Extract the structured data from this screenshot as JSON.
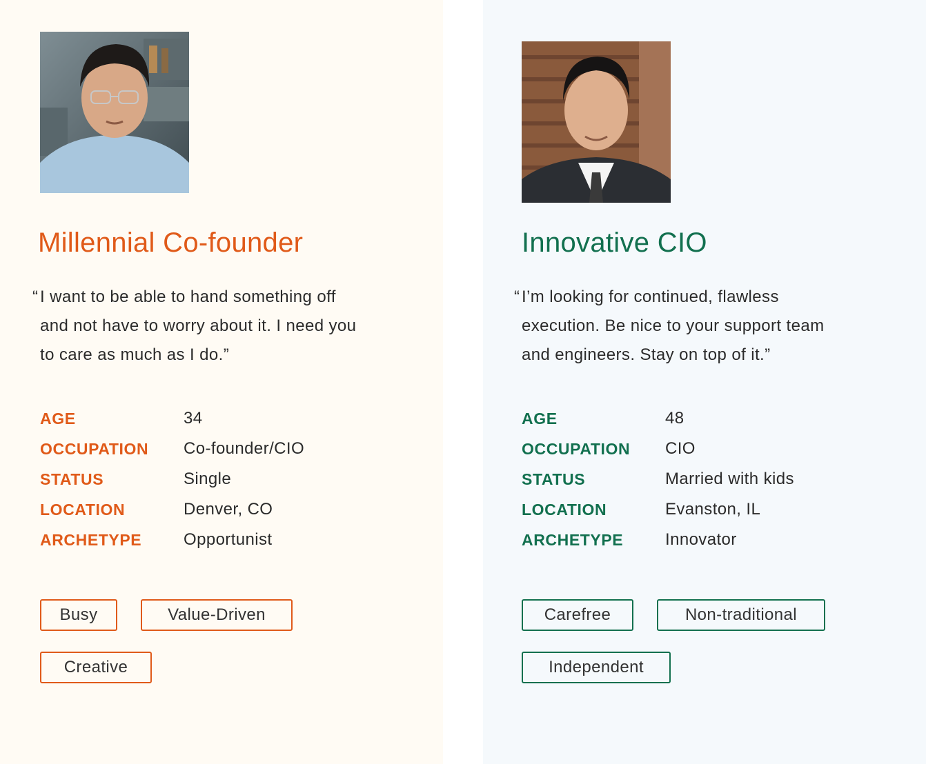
{
  "theme": {
    "left_accent": "#e05a19",
    "right_accent": "#12704f",
    "left_bg": "#fffbf4",
    "right_bg": "#f5f9fc"
  },
  "personas": [
    {
      "photo_icon": "person-portrait-icon",
      "title": "Millennial Co-founder",
      "quote_open": "“",
      "quote_lines": [
        "I want to be able to hand something off",
        "and not have to worry about it. I need you",
        "to care as much as I do.”"
      ],
      "facts": [
        {
          "label": "AGE",
          "value": "34"
        },
        {
          "label": "OCCUPATION",
          "value": "Co-founder/CIO"
        },
        {
          "label": "STATUS",
          "value": "Single"
        },
        {
          "label": "LOCATION",
          "value": "Denver, CO"
        },
        {
          "label": "ARCHETYPE",
          "value": "Opportunist"
        }
      ],
      "tags": [
        "Busy",
        "Value-Driven",
        "Creative"
      ]
    },
    {
      "photo_icon": "person-portrait-icon",
      "title": "Innovative CIO",
      "quote_open": "“",
      "quote_lines": [
        "I’m looking for continued, flawless",
        "execution. Be nice to your support team",
        "and engineers. Stay on top of it.”"
      ],
      "facts": [
        {
          "label": "AGE",
          "value": "48"
        },
        {
          "label": "OCCUPATION",
          "value": "CIO"
        },
        {
          "label": "STATUS",
          "value": "Married with kids"
        },
        {
          "label": "LOCATION",
          "value": "Evanston, IL"
        },
        {
          "label": "ARCHETYPE",
          "value": "Innovator"
        }
      ],
      "tags": [
        "Carefree",
        "Non-traditional",
        "Independent"
      ]
    }
  ]
}
